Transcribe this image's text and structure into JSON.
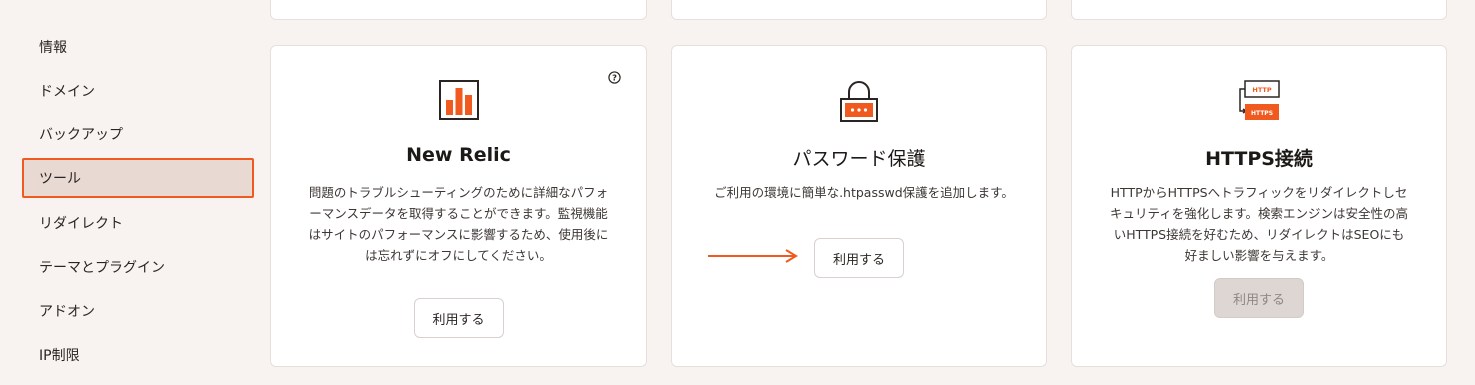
{
  "sidebar": {
    "items": [
      {
        "label": "情報"
      },
      {
        "label": "ドメイン"
      },
      {
        "label": "バックアップ"
      },
      {
        "label": "ツール"
      },
      {
        "label": "リダイレクト"
      },
      {
        "label": "テーマとプラグイン"
      },
      {
        "label": "アドオン"
      },
      {
        "label": "IP制限"
      }
    ],
    "active_index": 3
  },
  "cards": [
    {
      "title": "New Relic",
      "description": "問題のトラブルシューティングのために詳細なパフォーマンスデータを取得することができます。監視機能はサイトのパフォーマンスに影響するため、使用後には忘れずにオフにしてください。",
      "button": "利用する",
      "icon": "bar-chart-icon"
    },
    {
      "title": "パスワード保護",
      "description": "ご利用の環境に簡単な.htpasswd保護を追加します。",
      "button": "利用する",
      "icon": "lock-icon"
    },
    {
      "title": "HTTPS接続",
      "description": "HTTPからHTTPSへトラフィックをリダイレクトしセキュリティを強化します。検索エンジンは安全性の高いHTTPS接続を好むため、リダイレクトはSEOにも好ましい影響を与えます。",
      "button": "利用する",
      "button_disabled": true,
      "icon": "https-redirect-icon",
      "icon_text_top": "HTTP",
      "icon_text_bottom": "HTTPS"
    }
  ],
  "colors": {
    "accent": "#f05a1e",
    "background": "#f8f3f1"
  }
}
